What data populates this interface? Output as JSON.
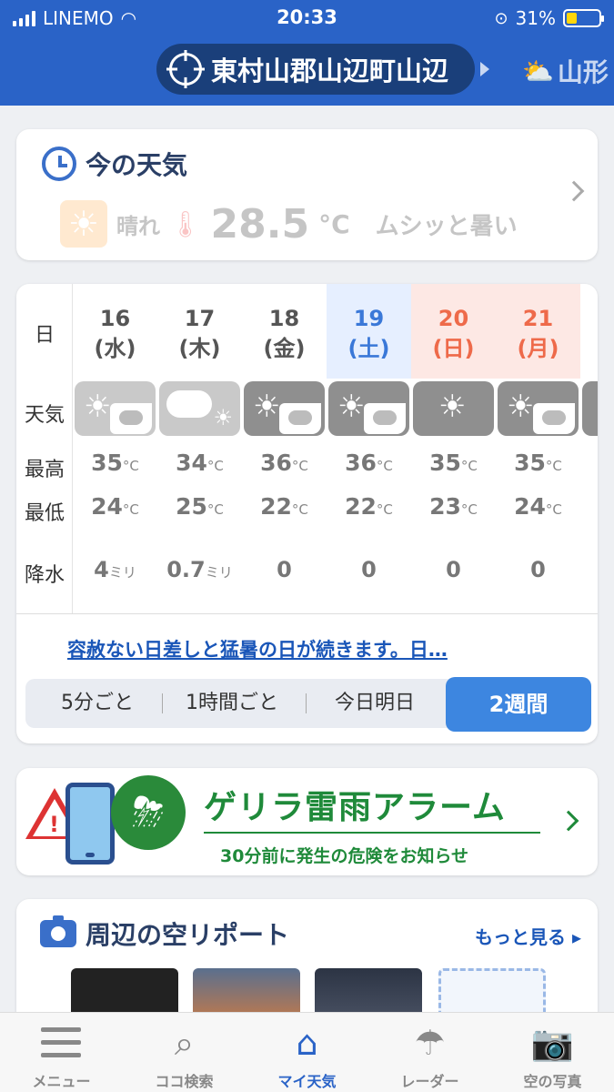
{
  "status_bar": {
    "carrier": "LINEMO",
    "time": "20:33",
    "battery": "31%",
    "battery_level": 0.31
  },
  "header": {
    "location": "東村山郡山辺町山辺",
    "next_location": "山形"
  },
  "now": {
    "title": "今の天気",
    "condition": "晴れ",
    "temp": "28.5",
    "unit": "°C",
    "description": "ムシッと暑い"
  },
  "forecast": {
    "row_labels": {
      "day": "日",
      "weather": "天気",
      "high": "最高",
      "low": "最低",
      "precip": "降水"
    },
    "unit_c": "°C",
    "days": [
      {
        "date": "16",
        "dow": "(水)",
        "weather": "sunny-rain-icon",
        "high": "35",
        "low": "24",
        "precip": "4",
        "precip_unit": "ミリ",
        "kind": "weekday"
      },
      {
        "date": "17",
        "dow": "(木)",
        "weather": "cloudy-sunny-icon",
        "high": "34",
        "low": "25",
        "precip": "0.7",
        "precip_unit": "ミリ",
        "kind": "weekday"
      },
      {
        "date": "18",
        "dow": "(金)",
        "weather": "sunny-cloudy-icon",
        "high": "36",
        "low": "22",
        "precip": "0",
        "precip_unit": "",
        "kind": "weekday"
      },
      {
        "date": "19",
        "dow": "(土)",
        "weather": "sunny-cloudy-icon",
        "high": "36",
        "low": "22",
        "precip": "0",
        "precip_unit": "",
        "kind": "saturday"
      },
      {
        "date": "20",
        "dow": "(日)",
        "weather": "sunny-icon",
        "high": "35",
        "low": "23",
        "precip": "0",
        "precip_unit": "",
        "kind": "holiday"
      },
      {
        "date": "21",
        "dow": "(月)",
        "weather": "sunny-cloudy-icon",
        "high": "35",
        "low": "24",
        "precip": "0",
        "precip_unit": "",
        "kind": "holiday"
      }
    ],
    "comment": "容赦ない日差しと猛暑の日が続きます。日…",
    "segments": [
      "5分ごと",
      "1時間ごと",
      "今日明日",
      "2週間"
    ],
    "active_segment": "2週間"
  },
  "banner": {
    "title": "ゲリラ雷雨アラーム",
    "subtitle": "30分前に発生の危険をお知らせ"
  },
  "report": {
    "title": "周辺の空リポート",
    "more": "もっと見る"
  },
  "tabs": [
    {
      "label": "メニュー",
      "icon": "menu-icon"
    },
    {
      "label": "ココ検索",
      "icon": "search-icon"
    },
    {
      "label": "マイ天気",
      "icon": "home-icon"
    },
    {
      "label": "レーダー",
      "icon": "umbrella-icon"
    },
    {
      "label": "空の写真",
      "icon": "camera-icon"
    }
  ],
  "active_tab": "マイ天気",
  "colors": {
    "brand": "#2a63c7",
    "saturday_bg": "#e6efff",
    "holiday_bg": "#fde8e4",
    "saturday_text": "#3a78d8",
    "holiday_text": "#ee6a4a",
    "accent_button": "#3d86e0",
    "banner_green": "#1f8a3a"
  }
}
